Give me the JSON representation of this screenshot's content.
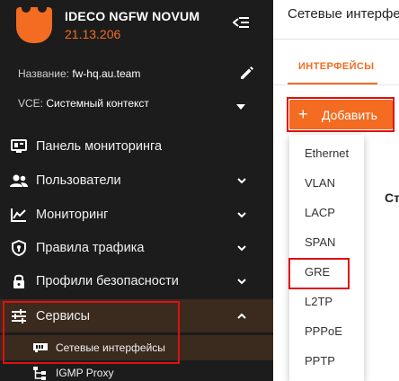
{
  "sidebar": {
    "product_name": "IDECO NGFW NOVUM",
    "version": "21.13.206",
    "name_label": "Название:",
    "name_value": "fw-hq.au.team",
    "vce_label": "VCE:",
    "vce_value": "Системный контекст",
    "nav": [
      {
        "label": "Панель мониторинга",
        "icon": "monitor-icon"
      },
      {
        "label": "Пользователи",
        "icon": "users-icon"
      },
      {
        "label": "Мониторинг",
        "icon": "chart-icon"
      },
      {
        "label": "Правила трафика",
        "icon": "shield-icon"
      },
      {
        "label": "Профили безопасности",
        "icon": "lock-icon"
      },
      {
        "label": "Сервисы",
        "icon": "sliders-icon"
      }
    ],
    "sub_items": [
      {
        "label": "Сетевые интерфейсы",
        "icon": "network-card-icon"
      },
      {
        "label": "IGMP Proxy",
        "icon": "tree-icon"
      }
    ]
  },
  "content": {
    "page_title": "Сетевые интерфейсы",
    "tab_interfaces": "ИНТЕРФЕЙСЫ",
    "add_button": "Добавить",
    "column_header": "Ст",
    "add_menu": [
      "Ethernet",
      "VLAN",
      "LACP",
      "SPAN",
      "GRE",
      "L2TP",
      "PPPoE",
      "PPTP"
    ]
  },
  "colors": {
    "accent": "#f36c21",
    "sidebar_bg": "#1c1c1c",
    "active_bg": "#3b2a1e",
    "highlight": "#e01010"
  }
}
